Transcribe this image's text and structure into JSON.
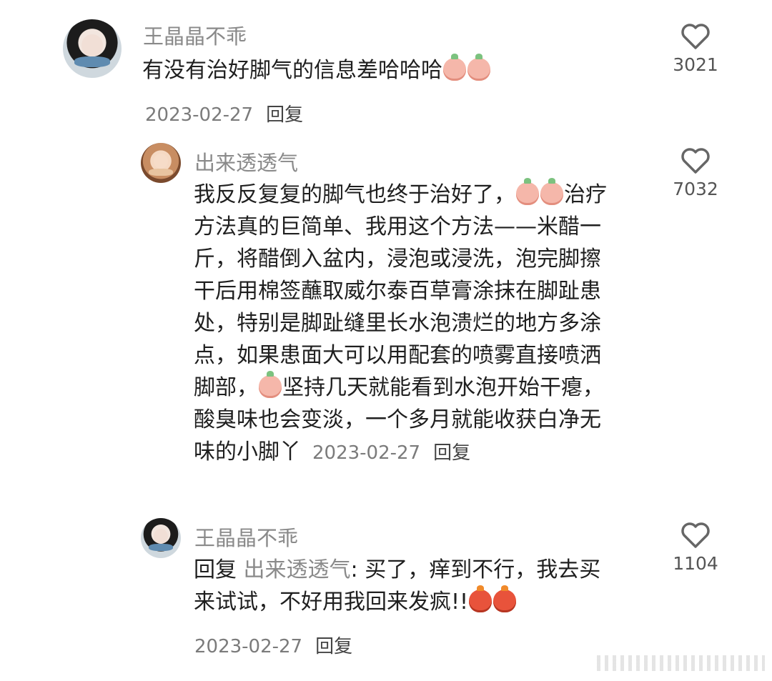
{
  "comments": [
    {
      "username": "王晶晶不乖",
      "text_lines": [
        "有没有治好脚气的信息差哈哈哈"
      ],
      "date": "2023-02-27",
      "reply_label": "回复",
      "likes": "3021"
    },
    {
      "username": "出来透透气",
      "text_lines": [
        "我反反复复的脚气也终于治好了，",
        "治疗",
        "方法真的巨简单、我用这个方法——米醋一",
        "斤，将醋倒入盆内，浸泡或浸洗，泡完脚擦",
        "干后用棉签蘸取威尔泰百草膏涂抹在脚趾患",
        "处，特别是脚趾缝里长水泡溃烂的地方多涂",
        "点，如果患面大可以用配套的喷雾直接喷洒",
        "脚部，",
        "坚持几天就能看到水泡开始干瘪，",
        "酸臭味也会变淡，一个多月就能收获白净无",
        "味的小脚丫"
      ],
      "date": "2023-02-27",
      "reply_label": "回复",
      "likes": "7032"
    },
    {
      "username": "王晶晶不乖",
      "reply_prefix": "回复",
      "mention": "出来透透气",
      "text_lines": [
        ": 买了，痒到不行，我去买",
        "来试试，不好用我回来发疯!!"
      ],
      "date": "2023-02-27",
      "reply_label": "回复",
      "likes": "1104"
    }
  ],
  "icons": {
    "like": "heart-outline-icon",
    "emoji_laugh_cry": "peach-laugh-cry-emoji",
    "emoji_shy": "peach-shy-emoji",
    "emoji_think": "peach-thinking-emoji",
    "emoji_angry": "angry-face-emoji"
  },
  "colors": {
    "username": "#8a8a8a",
    "text": "#1f1f1f",
    "meta": "#7b7b7b"
  }
}
